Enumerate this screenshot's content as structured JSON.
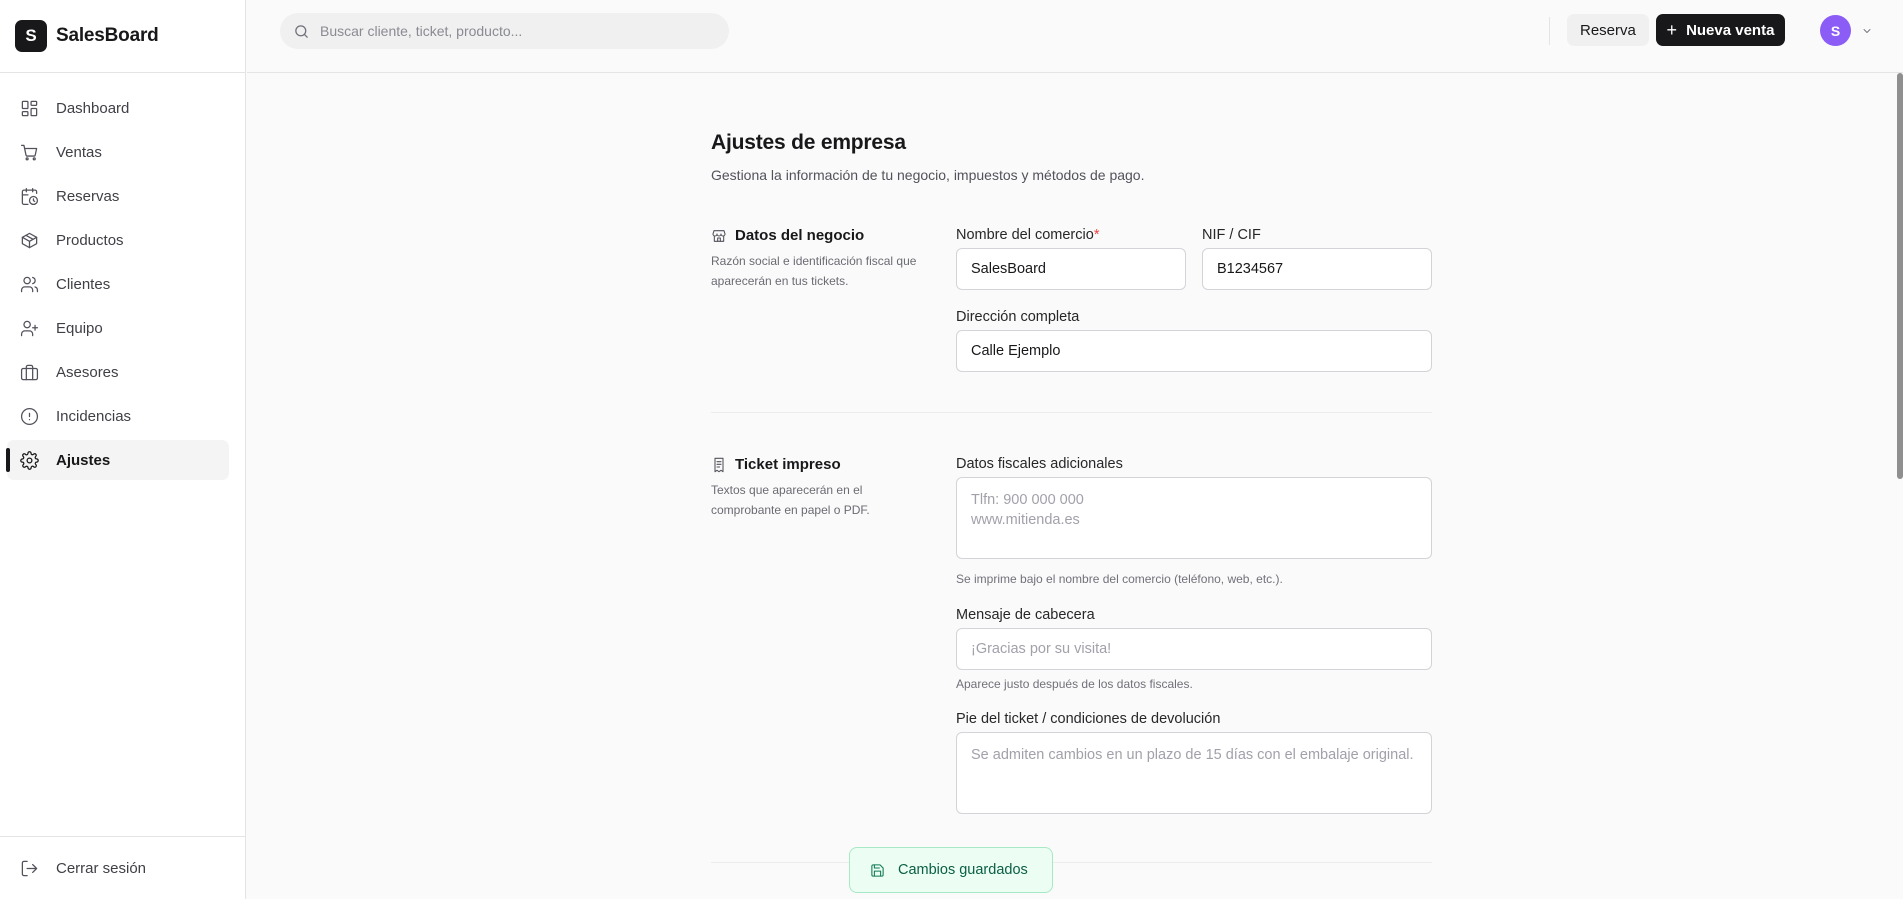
{
  "app": {
    "logo_letter": "S",
    "name": "SalesBoard"
  },
  "sidebar": {
    "items": [
      {
        "label": "Dashboard",
        "icon": "dashboard-icon"
      },
      {
        "label": "Ventas",
        "icon": "cart-icon"
      },
      {
        "label": "Reservas",
        "icon": "calendar-clock-icon"
      },
      {
        "label": "Productos",
        "icon": "package-icon"
      },
      {
        "label": "Clientes",
        "icon": "users-icon"
      },
      {
        "label": "Equipo",
        "icon": "user-plus-icon"
      },
      {
        "label": "Asesores",
        "icon": "briefcase-icon"
      },
      {
        "label": "Incidencias",
        "icon": "alert-circle-icon"
      },
      {
        "label": "Ajustes",
        "icon": "gear-icon",
        "active": true
      }
    ],
    "logout_label": "Cerrar sesión"
  },
  "topbar": {
    "search_placeholder": "Buscar cliente, ticket, producto...",
    "reserva_label": "Reserva",
    "nueva_venta_label": "Nueva venta",
    "avatar_letter": "S"
  },
  "page": {
    "title": "Ajustes de empresa",
    "subtitle": "Gestiona la información de tu negocio, impuestos y métodos de pago."
  },
  "business": {
    "title": "Datos del negocio",
    "description": "Razón social e identificación fiscal que aparecerán en tus tickets.",
    "name_label": "Nombre del comercio",
    "required_mark": "*",
    "name_value": "SalesBoard",
    "nif_label": "NIF / CIF",
    "nif_value": "B1234567",
    "address_label": "Dirección completa",
    "address_value": "Calle Ejemplo"
  },
  "ticket": {
    "title": "Ticket impreso",
    "description": "Textos que aparecerán en el comprobante en papel o PDF.",
    "fiscal_label": "Datos fiscales adicionales",
    "fiscal_placeholder": "Tlfn: 900 000 000\nwww.mitienda.es",
    "fiscal_hint": "Se imprime bajo el nombre del comercio (teléfono, web, etc.).",
    "header_label": "Mensaje de cabecera",
    "header_placeholder": "¡Gracias por su visita!",
    "header_hint": "Aparece justo después de los datos fiscales.",
    "footer_label": "Pie del ticket / condiciones de devolución",
    "footer_placeholder": "Se admiten cambios en un plazo de 15 días con el embalaje original."
  },
  "toast": {
    "label": "Cambios guardados",
    "icon": "save-icon"
  },
  "colors": {
    "primary": "#18181b",
    "avatar": "#8b5cf6",
    "required": "#ef4444",
    "toast_bg": "#ecfdf4",
    "toast_text": "#0b5f44"
  }
}
